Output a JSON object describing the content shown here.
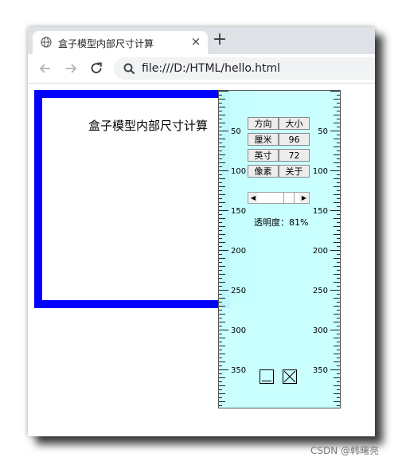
{
  "browser": {
    "tab_title": "盒子模型内部尺寸计算",
    "tab_close": "×",
    "new_tab": "+",
    "url": "file:///D:/HTML/hello.html"
  },
  "page": {
    "box_text": "盒子模型内部尺寸计算"
  },
  "ruler": {
    "buttons": [
      "方向",
      "大小",
      "厘米",
      "96",
      "英寸",
      "72",
      "像素",
      "关于"
    ],
    "opacity_text": "透明度：81%",
    "tick_labels": [
      "50",
      "100",
      "150",
      "200",
      "250",
      "300",
      "350"
    ]
  },
  "watermark": "CSDN @韩曙亮",
  "colors": {
    "box_border": "#0000ff",
    "ruler_bg": "#c6ffff",
    "overlay": "#8cb9ff",
    "tabbar": "#dee1e6"
  }
}
